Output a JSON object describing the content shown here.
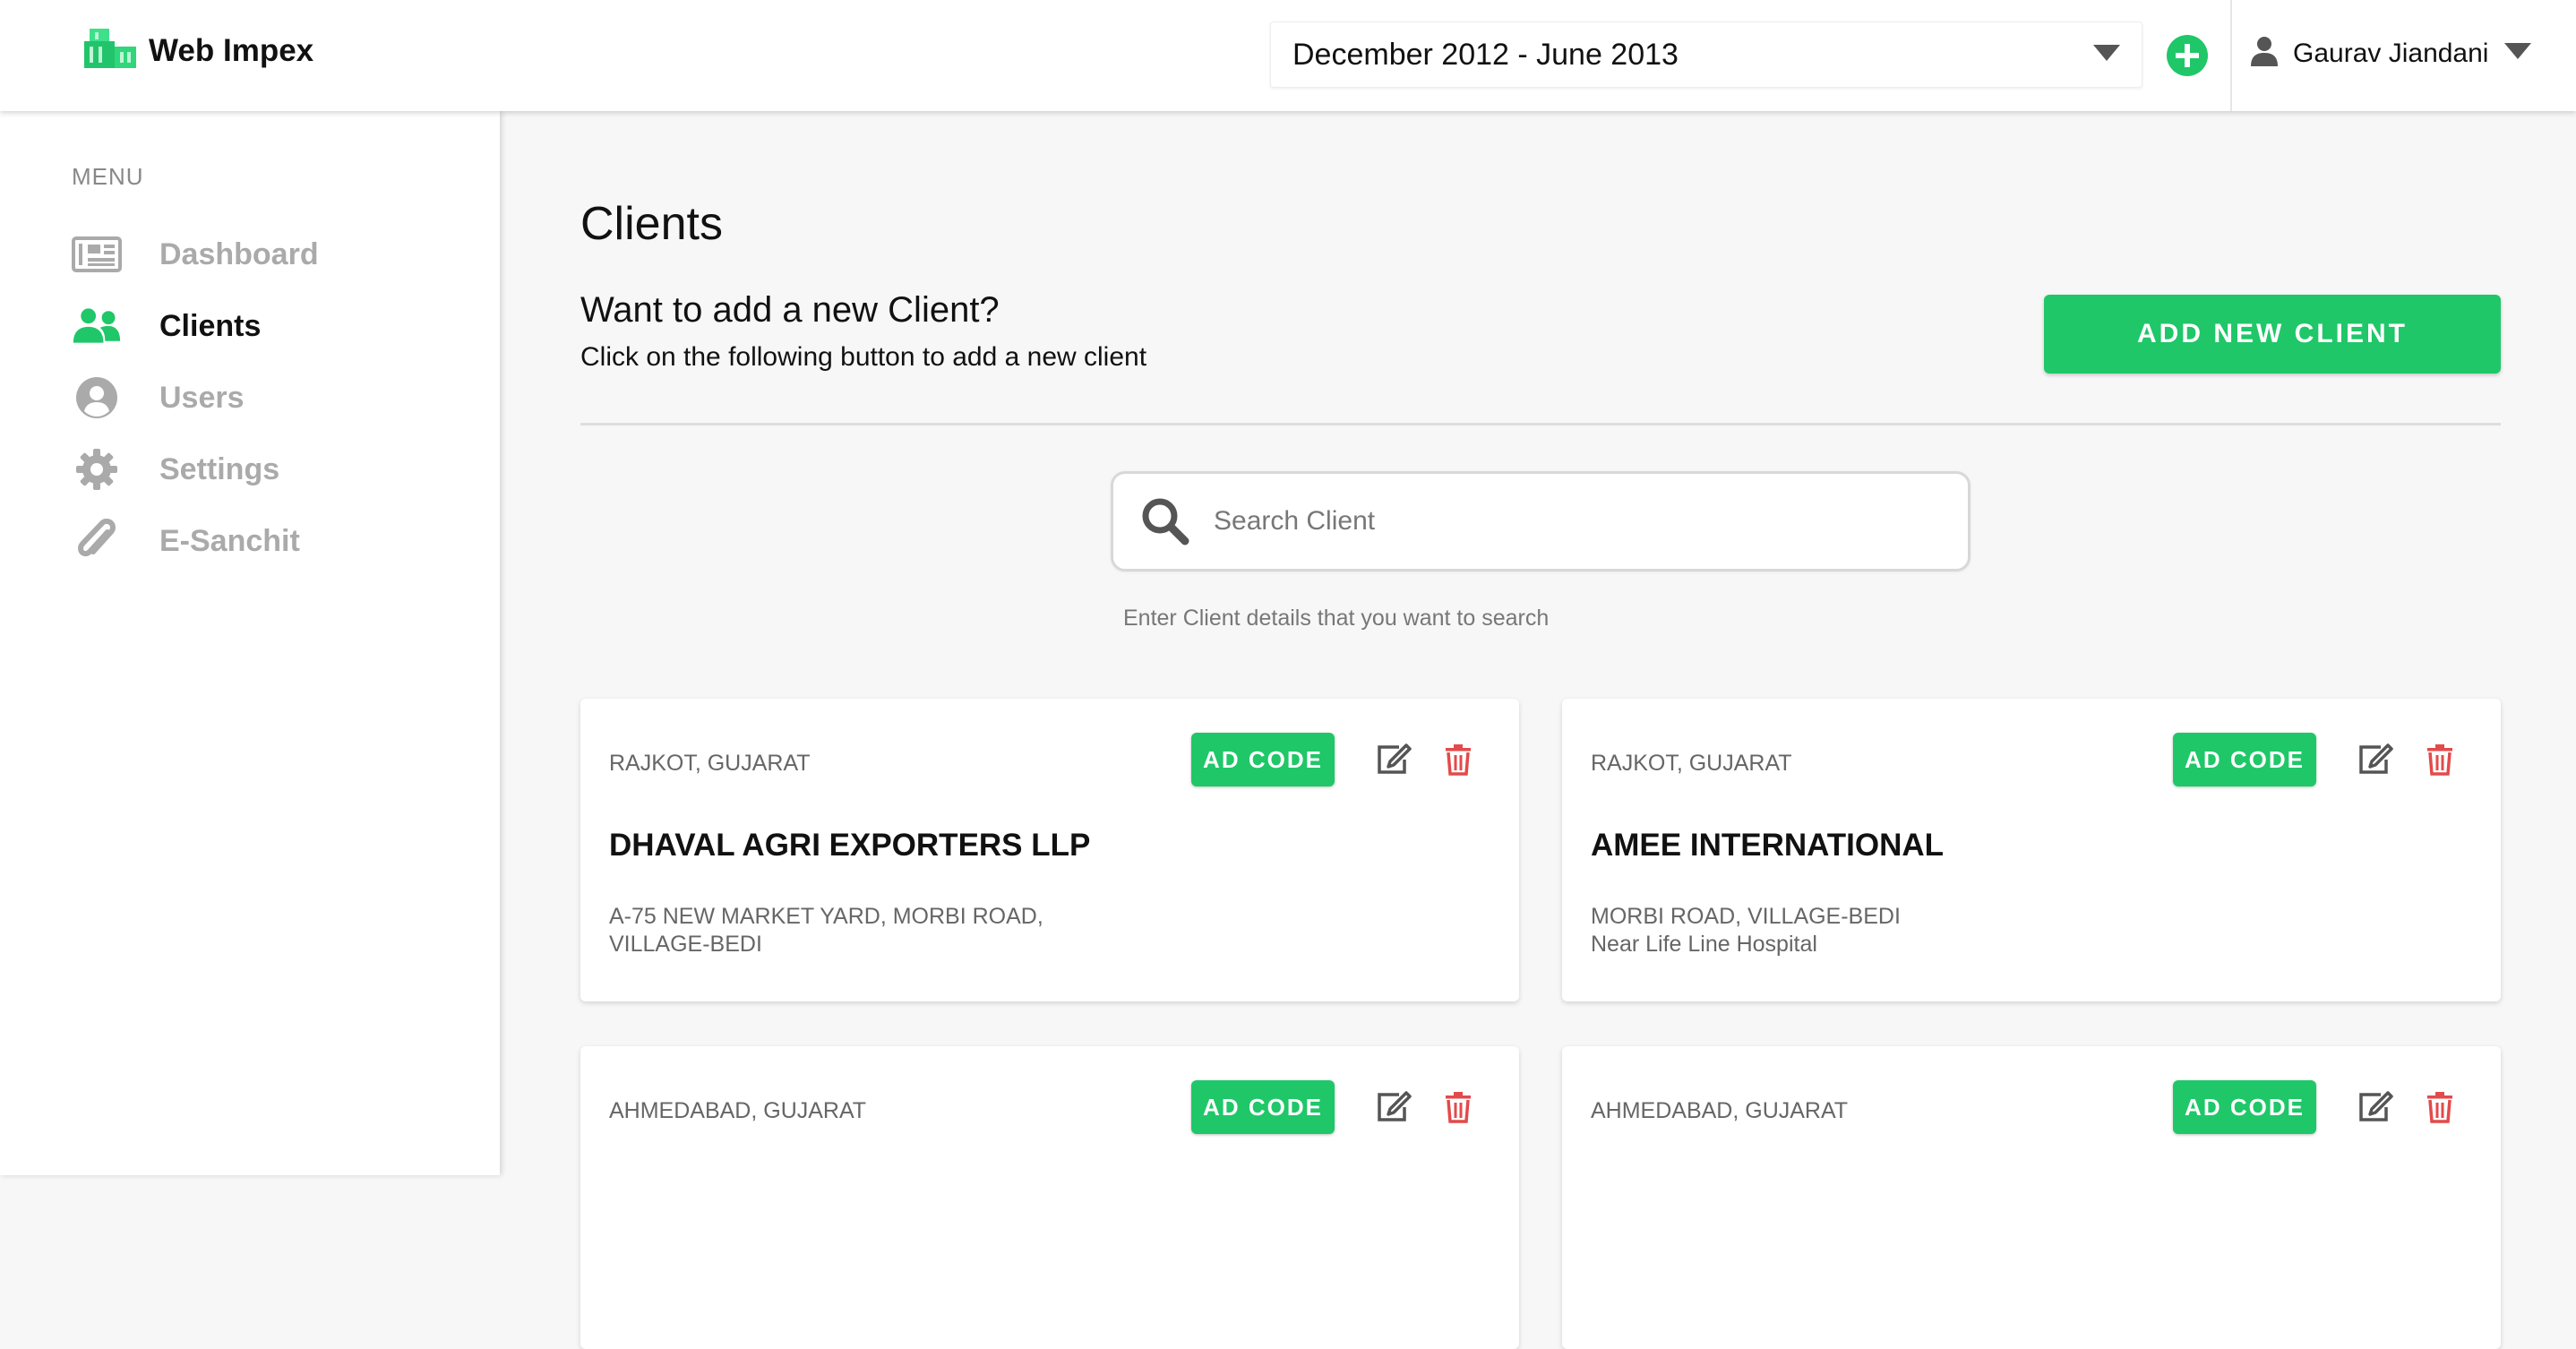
{
  "header": {
    "brand": "Web Impex",
    "period": "December 2012 - June 2013",
    "user_name": "Gaurav Jiandani"
  },
  "colors": {
    "accent": "#1fc768",
    "danger": "#e34a4a",
    "muted": "#aaaaaa"
  },
  "sidebar": {
    "menu_label": "MENU",
    "items": [
      {
        "label": "Dashboard",
        "icon": "newspaper-icon",
        "active": false
      },
      {
        "label": "Clients",
        "icon": "users-icon",
        "active": true
      },
      {
        "label": "Users",
        "icon": "user-circle-icon",
        "active": false
      },
      {
        "label": "Settings",
        "icon": "gear-icon",
        "active": false
      },
      {
        "label": "E-Sanchit",
        "icon": "paperclip-icon",
        "active": false
      }
    ]
  },
  "main": {
    "title": "Clients",
    "add_heading": "Want to add a new Client?",
    "add_sub": "Click on the following button to add a new client",
    "add_button": "ADD NEW CLIENT",
    "search_placeholder": "Search Client",
    "search_hint": "Enter Client details that you want to search",
    "ad_code_label": "AD CODE",
    "cards": [
      {
        "location": "RAJKOT, GUJARAT",
        "name": "DHAVAL AGRI EXPORTERS LLP",
        "address_line1": "A-75 NEW MARKET YARD, MORBI ROAD,",
        "address_line2": "VILLAGE-BEDI"
      },
      {
        "location": "RAJKOT, GUJARAT",
        "name": "AMEE INTERNATIONAL",
        "address_line1": "MORBI ROAD, VILLAGE-BEDI",
        "address_line2": "Near Life Line Hospital"
      },
      {
        "location": "AHMEDABAD, GUJARAT",
        "name": "",
        "address_line1": "",
        "address_line2": ""
      },
      {
        "location": "AHMEDABAD, GUJARAT",
        "name": "",
        "address_line1": "",
        "address_line2": ""
      }
    ]
  }
}
